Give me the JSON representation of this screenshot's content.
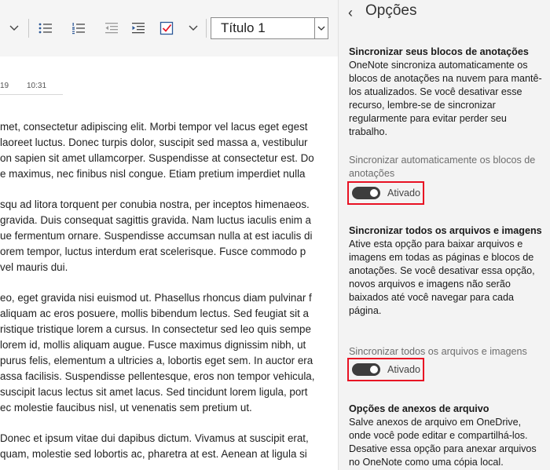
{
  "toolbar": {
    "style_value": "Título 1"
  },
  "doc": {
    "meta_left": "19",
    "meta_right": "10:31",
    "paragraphs": [
      [
        "met, consectetur adipiscing elit. Morbi tempor vel lacus eget egest",
        "laoreet luctus. Donec turpis dolor, suscipit sed massa a, vestibulur",
        "on sapien sit amet ullamcorper. Suspendisse at consectetur est. Do",
        "e maximus, nec finibus nisl congue. Etiam pretium imperdiet nulla"
      ],
      [
        "squ ad litora torquent per conubia nostra, per inceptos himenaeos.",
        "gravida. Duis consequat sagittis gravida. Nam luctus iaculis enim a",
        "ue fermentum ornare. Suspendisse accumsan nulla at est iaculis di",
        "orem tempor, luctus interdum erat scelerisque. Fusce commodo p",
        "vel mauris dui."
      ],
      [
        "eo, eget gravida nisi euismod ut. Phasellus rhoncus diam pulvinar f",
        "aliquam ac eros posuere, mollis bibendum lectus. Sed feugiat sit a",
        "ristique tristique lorem a cursus. In consectetur sed leo quis sempe",
        "lorem id, mollis aliquam augue. Fusce maximus dignissim nibh, ut",
        "purus felis, elementum a ultricies a, lobortis eget sem. In auctor era",
        "assa facilisis. Suspendisse pellentesque, eros non tempor vehicula,",
        "suscipit lacus lectus sit amet lacus. Sed tincidunt lorem ligula, port",
        "ec molestie faucibus nisl, ut venenatis sem pretium ut."
      ],
      [
        "Donec et ipsum vitae dui dapibus dictum. Vivamus at suscipit erat,",
        "quam, molestie sed lobortis ac, pharetra at est. Aenean at ligula si"
      ]
    ]
  },
  "panel": {
    "title": "Opções",
    "back_glyph": "‹",
    "sync_notebooks": {
      "heading": "Sincronizar seus blocos de anotações",
      "desc": "OneNote sincroniza automaticamente os blocos de anotações na nuvem para mantê-los atualizados. Se você desativar esse recurso, lembre-se de sincronizar regularmente para evitar perder seu trabalho.",
      "toggle_label": "Sincronizar automaticamente os blocos de anotações",
      "toggle_state": "Ativado",
      "on": true
    },
    "sync_files": {
      "heading": "Sincronizar todos os arquivos e imagens",
      "desc": "Ative esta opção para baixar arquivos e imagens em todas as páginas e blocos de anotações. Se você desativar essa opção, novos arquivos e imagens não serão baixados até você navegar para cada página.",
      "toggle_label": "Sincronizar todos os arquivos e imagens",
      "toggle_state": "Ativado",
      "on": true
    },
    "attachments": {
      "heading": "Opções de anexos de arquivo",
      "desc": "Salve anexos de arquivo em OneDrive, onde você pode editar e compartilhá-los. Desative essa opção para anexar arquivos no OneNote como uma cópia local."
    }
  },
  "colors": {
    "highlight": "#e81123",
    "toggle_on": "#3d3d3d",
    "panel_bg": "#f3f3f3",
    "checkbox_accent": "#e81123"
  }
}
